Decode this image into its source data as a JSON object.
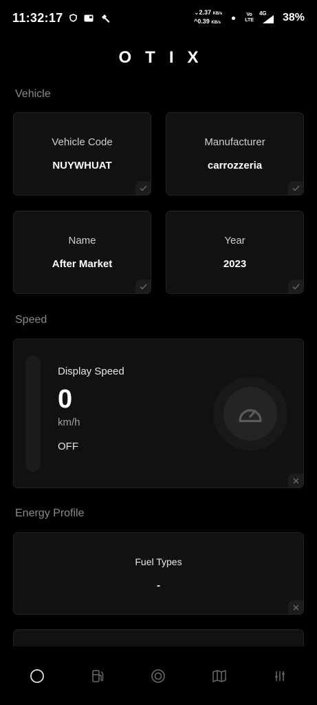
{
  "status_bar": {
    "time": "11:32:17",
    "net_down": "2.37",
    "net_up": "0.39",
    "net_unit": "KB/s",
    "volte_top": "Vo",
    "volte_bottom": "LTE",
    "network": "4G",
    "battery": "38%"
  },
  "brand": "OTIX",
  "sections": {
    "vehicle": "Vehicle",
    "speed": "Speed",
    "energy": "Energy Profile"
  },
  "vehicle_cards": [
    {
      "label": "Vehicle Code",
      "value": "NUYWHUAT"
    },
    {
      "label": "Manufacturer",
      "value": "carrozzeria"
    },
    {
      "label": "Name",
      "value": "After Market"
    },
    {
      "label": "Year",
      "value": "2023"
    }
  ],
  "speed": {
    "label": "Display Speed",
    "value": "0",
    "unit": "km/h",
    "state": "OFF"
  },
  "energy": {
    "label": "Fuel Types",
    "value": "-"
  },
  "icons": {
    "vehicle_card_badge": "check-icon",
    "speed_badge": "close-icon",
    "fuel_badge": "close-icon",
    "gauge": "speedometer-icon",
    "nav": [
      "home-circle-icon",
      "fuel-pump-icon",
      "target-icon",
      "map-icon",
      "sliders-icon"
    ]
  },
  "colors": {
    "background": "#000000",
    "card": "#111113",
    "muted_text": "#8a8a8a"
  }
}
